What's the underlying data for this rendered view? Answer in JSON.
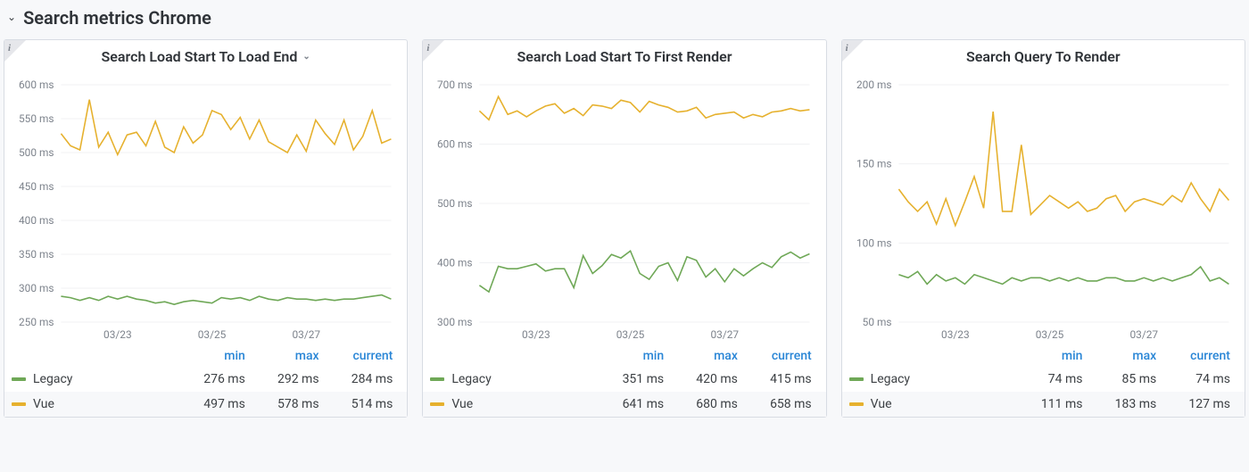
{
  "section_title": "Search metrics Chrome",
  "legend_headers": {
    "min": "min",
    "max": "max",
    "current": "current"
  },
  "series_meta": {
    "legacy": {
      "label": "Legacy",
      "color": "#6fa857"
    },
    "vue": {
      "label": "Vue",
      "color": "#e6b12e"
    }
  },
  "panels": [
    {
      "id": "load-start-to-end",
      "title": "Search Load Start To Load End",
      "has_dropdown": true,
      "stats": {
        "legacy": {
          "min": "276 ms",
          "max": "292 ms",
          "current": "284 ms"
        },
        "vue": {
          "min": "497 ms",
          "max": "578 ms",
          "current": "514 ms"
        }
      }
    },
    {
      "id": "load-start-to-first-render",
      "title": "Search Load Start To First Render",
      "has_dropdown": false,
      "stats": {
        "legacy": {
          "min": "351 ms",
          "max": "420 ms",
          "current": "415 ms"
        },
        "vue": {
          "min": "641 ms",
          "max": "680 ms",
          "current": "658 ms"
        }
      }
    },
    {
      "id": "query-to-render",
      "title": "Search Query To Render",
      "has_dropdown": false,
      "stats": {
        "legacy": {
          "min": "74 ms",
          "max": "85 ms",
          "current": "74 ms"
        },
        "vue": {
          "min": "111 ms",
          "max": "183 ms",
          "current": "127 ms"
        }
      }
    }
  ],
  "chart_data": [
    {
      "type": "line",
      "title": "Search Load Start To Load End",
      "xlabel": "",
      "ylabel": "",
      "ylim": [
        250,
        600
      ],
      "yticks": [
        250,
        300,
        350,
        400,
        450,
        500,
        550,
        600
      ],
      "ytick_labels": [
        "250 ms",
        "300 ms",
        "350 ms",
        "400 ms",
        "450 ms",
        "500 ms",
        "550 ms",
        "600 ms"
      ],
      "x": [
        0,
        1,
        2,
        3,
        4,
        5,
        6,
        7,
        8,
        9,
        10,
        11,
        12,
        13,
        14,
        15,
        16,
        17,
        18,
        19,
        20,
        21,
        22,
        23,
        24,
        25,
        26,
        27,
        28,
        29,
        30,
        31,
        32,
        33,
        34,
        35
      ],
      "x_tick_positions": [
        6,
        16,
        26
      ],
      "x_tick_labels": [
        "03/23",
        "03/25",
        "03/27"
      ],
      "series": [
        {
          "name": "Legacy",
          "color": "#6fa857",
          "values": [
            288,
            286,
            282,
            286,
            282,
            288,
            284,
            288,
            284,
            282,
            278,
            280,
            276,
            280,
            282,
            280,
            278,
            286,
            284,
            286,
            282,
            288,
            284,
            282,
            286,
            284,
            284,
            282,
            284,
            282,
            284,
            284,
            286,
            288,
            290,
            284
          ]
        },
        {
          "name": "Vue",
          "color": "#e6b12e",
          "values": [
            528,
            510,
            504,
            578,
            508,
            530,
            497,
            526,
            530,
            510,
            546,
            508,
            500,
            538,
            514,
            526,
            562,
            556,
            534,
            552,
            520,
            548,
            516,
            508,
            500,
            526,
            502,
            548,
            528,
            512,
            548,
            504,
            524,
            562,
            514,
            520
          ]
        }
      ]
    },
    {
      "type": "line",
      "title": "Search Load Start To First Render",
      "xlabel": "",
      "ylabel": "",
      "ylim": [
        300,
        700
      ],
      "yticks": [
        300,
        400,
        500,
        600,
        700
      ],
      "ytick_labels": [
        "300 ms",
        "400 ms",
        "500 ms",
        "600 ms",
        "700 ms"
      ],
      "x": [
        0,
        1,
        2,
        3,
        4,
        5,
        6,
        7,
        8,
        9,
        10,
        11,
        12,
        13,
        14,
        15,
        16,
        17,
        18,
        19,
        20,
        21,
        22,
        23,
        24,
        25,
        26,
        27,
        28,
        29,
        30,
        31,
        32,
        33,
        34,
        35
      ],
      "x_tick_positions": [
        6,
        16,
        26
      ],
      "x_tick_labels": [
        "03/23",
        "03/25",
        "03/27"
      ],
      "series": [
        {
          "name": "Legacy",
          "color": "#6fa857",
          "values": [
            362,
            351,
            394,
            390,
            390,
            394,
            398,
            386,
            390,
            390,
            358,
            412,
            382,
            395,
            414,
            408,
            420,
            382,
            372,
            394,
            400,
            370,
            410,
            404,
            376,
            390,
            368,
            390,
            378,
            390,
            400,
            392,
            410,
            418,
            408,
            415
          ]
        },
        {
          "name": "Vue",
          "color": "#e6b12e",
          "values": [
            656,
            641,
            680,
            650,
            656,
            646,
            656,
            664,
            668,
            652,
            660,
            648,
            666,
            664,
            660,
            674,
            670,
            654,
            672,
            666,
            662,
            654,
            656,
            662,
            644,
            650,
            652,
            654,
            644,
            650,
            646,
            654,
            656,
            660,
            656,
            658
          ]
        }
      ]
    },
    {
      "type": "line",
      "title": "Search Query To Render",
      "xlabel": "",
      "ylabel": "",
      "ylim": [
        50,
        200
      ],
      "yticks": [
        50,
        100,
        150,
        200
      ],
      "ytick_labels": [
        "50 ms",
        "100 ms",
        "150 ms",
        "200 ms"
      ],
      "x": [
        0,
        1,
        2,
        3,
        4,
        5,
        6,
        7,
        8,
        9,
        10,
        11,
        12,
        13,
        14,
        15,
        16,
        17,
        18,
        19,
        20,
        21,
        22,
        23,
        24,
        25,
        26,
        27,
        28,
        29,
        30,
        31,
        32,
        33,
        34,
        35
      ],
      "x_tick_positions": [
        6,
        16,
        26
      ],
      "x_tick_labels": [
        "03/23",
        "03/25",
        "03/27"
      ],
      "series": [
        {
          "name": "Legacy",
          "color": "#6fa857",
          "values": [
            80,
            78,
            82,
            74,
            80,
            76,
            78,
            74,
            80,
            78,
            76,
            74,
            78,
            76,
            78,
            78,
            76,
            78,
            76,
            78,
            76,
            76,
            78,
            78,
            76,
            76,
            78,
            76,
            78,
            76,
            78,
            80,
            85,
            76,
            78,
            74
          ]
        },
        {
          "name": "Vue",
          "color": "#e6b12e",
          "values": [
            134,
            126,
            120,
            126,
            112,
            128,
            111,
            126,
            142,
            122,
            183,
            120,
            120,
            162,
            118,
            124,
            130,
            126,
            122,
            126,
            120,
            122,
            128,
            130,
            120,
            126,
            128,
            126,
            124,
            130,
            126,
            138,
            128,
            120,
            134,
            127
          ]
        }
      ]
    }
  ]
}
